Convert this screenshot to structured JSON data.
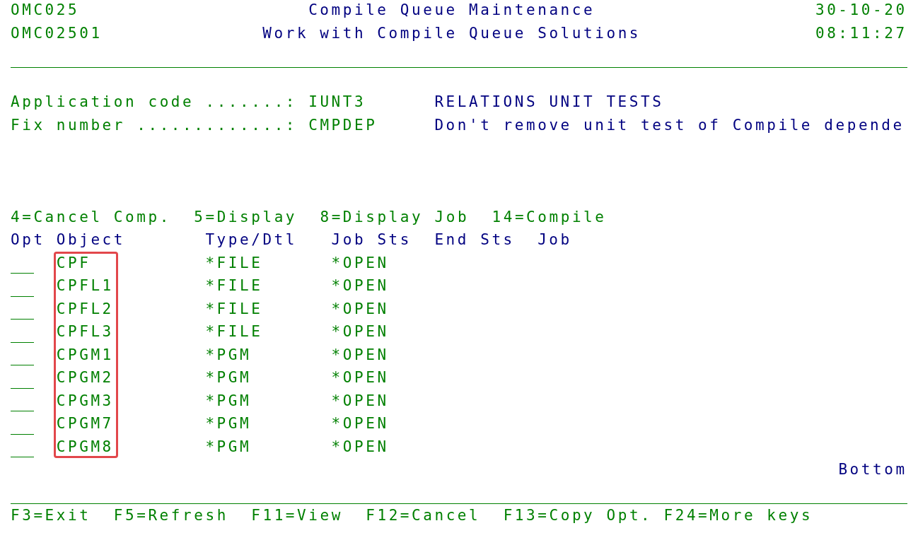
{
  "header": {
    "program": "OMC025",
    "title": "Compile Queue Maintenance",
    "date": "30-10-20",
    "format": "OMC02501",
    "subtitle": "Work with Compile Queue Solutions",
    "time": "08:11:27"
  },
  "fields": [
    {
      "label": "Application code .......:",
      "value": "IUNT3",
      "description": "RELATIONS UNIT TESTS"
    },
    {
      "label": "Fix number .............:",
      "value": "CMPDEP",
      "description": "Don't remove unit test of Compile depende"
    }
  ],
  "options": [
    "4=Cancel Comp.",
    "5=Display",
    "8=Display Job",
    "14=Compile"
  ],
  "table": {
    "columns": [
      {
        "label": "Opt",
        "highlighted": false
      },
      {
        "label": "Object",
        "highlighted": true
      },
      {
        "label": "Type/Dtl",
        "highlighted": false
      },
      {
        "label": "Job Sts",
        "highlighted": false
      },
      {
        "label": "End Sts",
        "highlighted": false
      },
      {
        "label": "Job",
        "highlighted": false
      }
    ],
    "rows": [
      {
        "object": "CPF",
        "type": "*FILE",
        "job_status": "*OPEN"
      },
      {
        "object": "CPFL1",
        "type": "*FILE",
        "job_status": "*OPEN"
      },
      {
        "object": "CPFL2",
        "type": "*FILE",
        "job_status": "*OPEN"
      },
      {
        "object": "CPFL3",
        "type": "*FILE",
        "job_status": "*OPEN"
      },
      {
        "object": "CPGM1",
        "type": "*PGM",
        "job_status": "*OPEN"
      },
      {
        "object": "CPGM2",
        "type": "*PGM",
        "job_status": "*OPEN"
      },
      {
        "object": "CPGM3",
        "type": "*PGM",
        "job_status": "*OPEN"
      },
      {
        "object": "CPGM7",
        "type": "*PGM",
        "job_status": "*OPEN"
      },
      {
        "object": "CPGM8",
        "type": "*PGM",
        "job_status": "*OPEN"
      }
    ]
  },
  "position_indicator": "Bottom",
  "function_keys": [
    "F3=Exit",
    "F5=Refresh",
    "F11=View",
    "F12=Cancel",
    "F13=Copy Opt.",
    "F24=More keys"
  ]
}
